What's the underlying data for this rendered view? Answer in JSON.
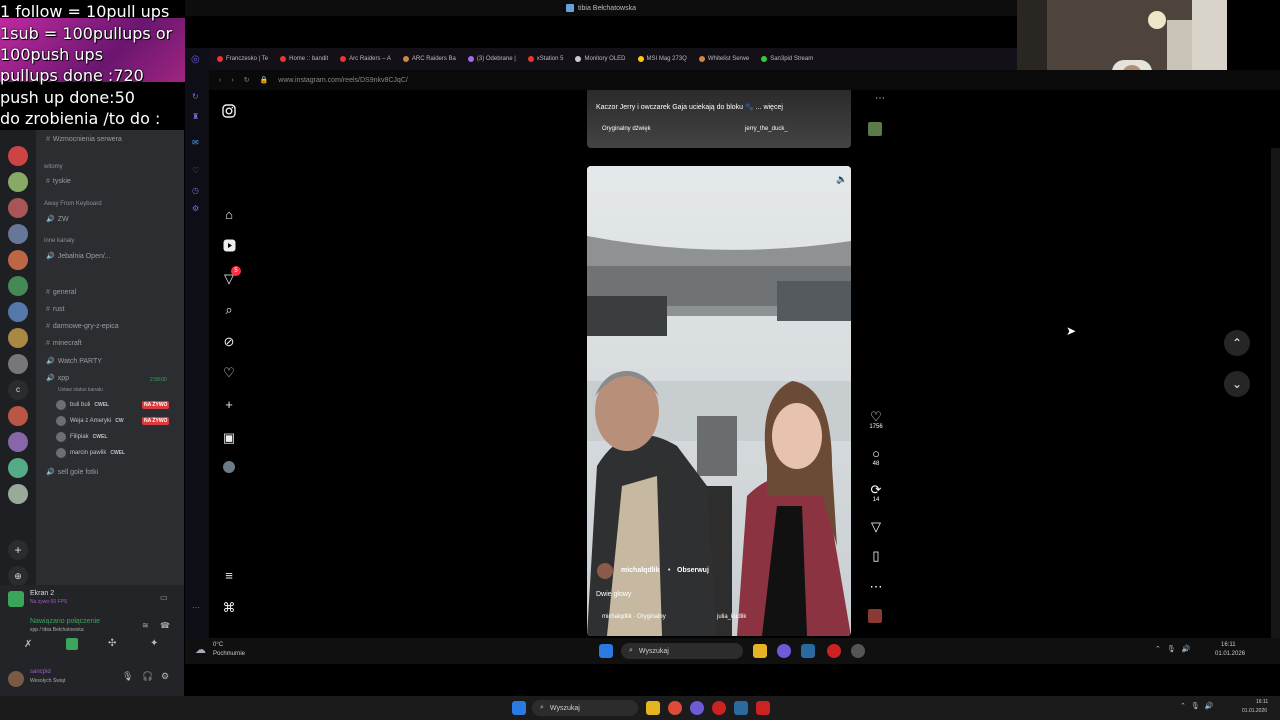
{
  "window_title": "tibia Bełchatowska",
  "overlay": {
    "lines": [
      "1 follow = 10pull ups",
      "1sub = 100pullups or 100push ups",
      "pullups done :720",
      "push up done:50",
      "do zrobienia /to do :"
    ]
  },
  "discord": {
    "channels": [
      {
        "kind": "hash",
        "label": "Wzmocnienia serwera"
      },
      {
        "kind": "cat",
        "label": "witomy"
      },
      {
        "kind": "hash",
        "label": "tyskie"
      },
      {
        "kind": "cat",
        "label": "Away From Keyboard"
      },
      {
        "kind": "voice",
        "label": "ZW"
      },
      {
        "kind": "cat",
        "label": "inne kanały"
      },
      {
        "kind": "voice",
        "label": "Jebalnia Open/..."
      },
      {
        "kind": "hash",
        "label": "general"
      },
      {
        "kind": "hash",
        "label": "rust"
      },
      {
        "kind": "hash",
        "label": "darmowe-gry-z-epica"
      },
      {
        "kind": "hash",
        "label": "minecraft"
      },
      {
        "kind": "voice",
        "label": "Watch PARTY"
      },
      {
        "kind": "voice",
        "label": "xpp"
      }
    ],
    "voice_status": "Ustaw status kanału",
    "voice_timer": "2:58:00",
    "voice_users": [
      {
        "name": "buli buli",
        "tag": "CWEL",
        "live": "NA ŻYWO"
      },
      {
        "name": "Weja z Ameryki",
        "tag": "CW",
        "live": "NA ŻYWO"
      },
      {
        "name": "Filipiak",
        "tag": "CWEL",
        "live": ""
      },
      {
        "name": "marcin pawlik",
        "tag": "CWEL",
        "live": ""
      }
    ],
    "last_channel": "sell gole fotki",
    "screen_share": {
      "title": "Ekran 2",
      "sub": "Na żywo 60 FPS"
    },
    "connection": {
      "title": "Nawiązano połączenie",
      "sub": "xpp / tibia Bełchatowska"
    },
    "user": {
      "name": "sancpid",
      "status": "Wesołych Świąt"
    }
  },
  "browser": {
    "tabs": [
      {
        "label": "Franczesko | Te",
        "color": "#e33"
      },
      {
        "label": "Home :: bandit",
        "color": "#e33"
      },
      {
        "label": "Arc Raiders – A",
        "color": "#e33"
      },
      {
        "label": "ARC Raiders Ba",
        "color": "#c84"
      },
      {
        "label": "(3) Odebrane |",
        "color": "#a6e"
      },
      {
        "label": "xStation 5",
        "color": "#e33"
      },
      {
        "label": "Monitory OLED",
        "color": "#ccc"
      },
      {
        "label": "MSI Mag 273Q",
        "color": "#fc0"
      },
      {
        "label": "Whitelist Serwe",
        "color": "#c84"
      },
      {
        "label": "San3pid Stream",
        "color": "#3c3"
      }
    ],
    "url": "www.instagram.com/reels/DS9nkv8CJqC/"
  },
  "reel_prev": {
    "caption": "Kaczor Jerry i owczarek Gaja uciekają do bloku 🐾 ... więcej",
    "audio": "Oryginalny dźwięk",
    "user": "jerry_the_duck_"
  },
  "reel": {
    "username": "michalqdlik",
    "follow": "Obserwuj",
    "caption": "Dwie głowy",
    "audio": "michalqdlik · Oryginalny",
    "tagged": "julia_kudlik",
    "likes": "1756",
    "comments": "48",
    "reposts": "14"
  },
  "notification_count": "5",
  "inner_taskbar": {
    "temp": "0°C",
    "weather": "Pochmurnie",
    "search": "Wyszukaj",
    "time": "16:11",
    "date": "01.01.2026"
  },
  "outer_taskbar": {
    "search": "Wyszukaj",
    "time": "16:11",
    "date": "01.01.2026"
  }
}
